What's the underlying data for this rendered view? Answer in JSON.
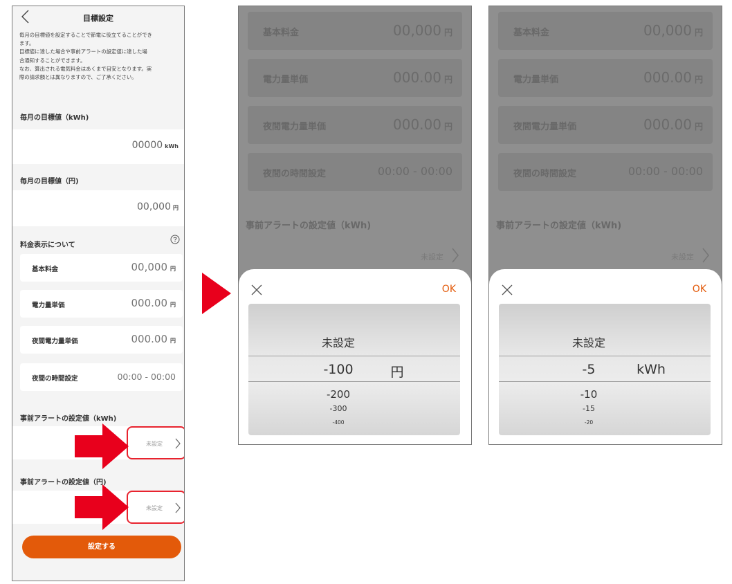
{
  "left": {
    "header": {
      "title": "目標設定"
    },
    "description": [
      "毎月の目標値を設定することで節電に役立てることができ",
      "ます。",
      "目標値に達した場合や事前アラートの設定値に達した場",
      "合通知することができます。",
      "なお、算出される電気料金はあくまで目安となります。実",
      "際の請求額とは異なりますので、ご了承ください。"
    ],
    "monthly_kwh": {
      "label": "毎月の目標値（kWh)",
      "value": "00000",
      "unit": "kWh"
    },
    "monthly_yen": {
      "label": "毎月の目標値（円)",
      "value": "00,000",
      "unit": "円"
    },
    "price_section": {
      "label": "料金表示について",
      "rows": [
        {
          "label": "基本料金",
          "value": "00,000",
          "unit": "円"
        },
        {
          "label": "電力量単価",
          "value": "000.00",
          "unit": "円"
        },
        {
          "label": "夜間電力量単価",
          "value": "000.00",
          "unit": "円"
        },
        {
          "label": "夜間の時間設定",
          "value": "00:00 - 00:00",
          "unit": ""
        }
      ]
    },
    "alert_kwh": {
      "label": "事前アラートの設定値（kWh)",
      "value": "未設定"
    },
    "alert_yen": {
      "label": "事前アラートの設定値（円)",
      "value": "未設定"
    },
    "submit_label": "設定する"
  },
  "modal_bg": {
    "rows": [
      {
        "label": "基本料金",
        "value": "00,000",
        "unit": "円"
      },
      {
        "label": "電力量単価",
        "value": "000.00",
        "unit": "円"
      },
      {
        "label": "夜間電力量単価",
        "value": "000.00",
        "unit": "円"
      },
      {
        "label": "夜間の時間設定",
        "value": "00:00 - 00:00",
        "unit": ""
      }
    ],
    "alert_label": "事前アラートの設定値（kWh)",
    "alert_value": "未設定"
  },
  "picker_yen": {
    "ok": "OK",
    "unit": "円",
    "items": [
      "未設定",
      "-100",
      "-200",
      "-300",
      "-400"
    ]
  },
  "picker_kwh": {
    "ok": "OK",
    "unit": "kWh",
    "items": [
      "未設定",
      "-5",
      "-10",
      "-15",
      "-20"
    ]
  },
  "colors": {
    "accent": "#e35a0a",
    "highlight": "#e8232e"
  }
}
